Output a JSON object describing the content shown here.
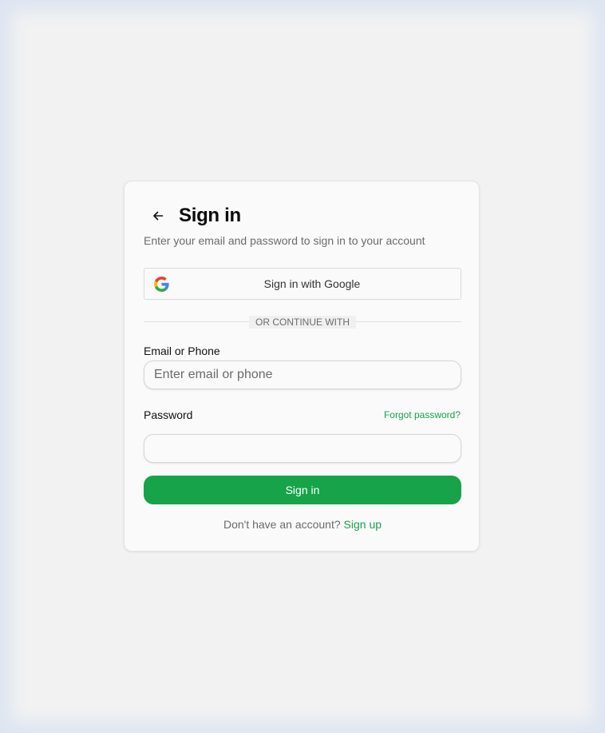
{
  "header": {
    "title": "Sign in",
    "subtitle": "Enter your email and password to sign in to your account"
  },
  "google": {
    "label": "Sign in with Google",
    "icon": "google-icon"
  },
  "divider": {
    "text": "OR CONTINUE WITH"
  },
  "email": {
    "label": "Email or Phone",
    "placeholder": "Enter email or phone",
    "value": ""
  },
  "password": {
    "label": "Password",
    "forgot_label": "Forgot password?",
    "value": ""
  },
  "submit": {
    "label": "Sign in"
  },
  "footer": {
    "prompt": "Don't have an account?",
    "signup_label": "Sign up"
  },
  "colors": {
    "accent": "#16a34a",
    "background": "#f2f2f2",
    "card": "#fafafa"
  }
}
